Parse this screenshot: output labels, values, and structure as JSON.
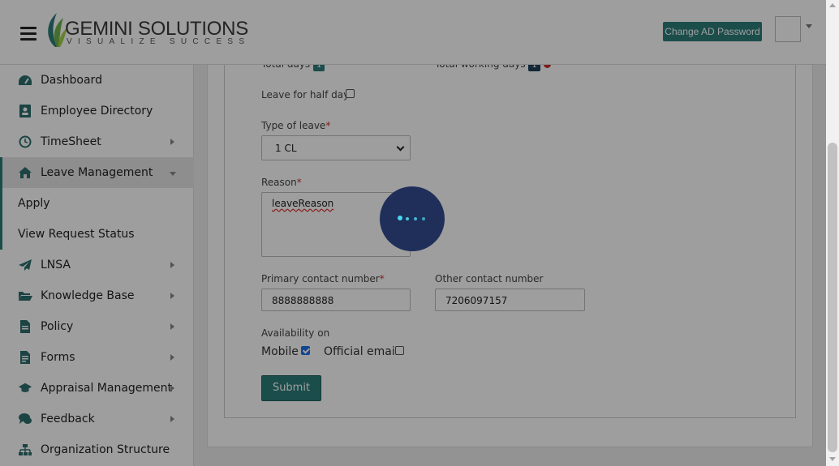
{
  "header": {
    "logo_title": "GEMINI SOLUTIONS",
    "logo_tagline": "VISUALIZE SUCCESS",
    "change_password_label": "Change AD Password"
  },
  "sidebar": {
    "items": [
      {
        "label": "Dashboard",
        "icon": "dashboard-icon"
      },
      {
        "label": "Employee Directory",
        "icon": "address-book-icon"
      },
      {
        "label": "TimeSheet",
        "icon": "clock-icon"
      },
      {
        "label": "Leave Management",
        "icon": "home-icon"
      },
      {
        "label": "Apply"
      },
      {
        "label": "View Request Status"
      },
      {
        "label": "LNSA",
        "icon": "paper-plane-icon"
      },
      {
        "label": "Knowledge Base",
        "icon": "folder-open-icon"
      },
      {
        "label": "Policy",
        "icon": "document-icon"
      },
      {
        "label": "Forms",
        "icon": "forms-icon"
      },
      {
        "label": "Appraisal Management",
        "icon": "graduation-cap-icon"
      },
      {
        "label": "Feedback",
        "icon": "comments-icon"
      },
      {
        "label": "Organization Structure",
        "icon": "sitemap-icon"
      }
    ]
  },
  "form": {
    "total_days_label": "Total days",
    "total_days_value": "1",
    "total_working_days_label": "Total working days",
    "total_working_days_value": "1",
    "half_day_label": "Leave for half day",
    "leave_type_label": "Type of leave",
    "leave_type_value": "1 CL",
    "reason_label": "Reason",
    "reason_value": "leaveReason",
    "primary_contact_label": "Primary contact number",
    "primary_contact_value": "8888888888",
    "other_contact_label": "Other contact number",
    "other_contact_value": "7206097157",
    "availability_label": "Availability on",
    "mobile_label": "Mobile",
    "mobile_checked": true,
    "email_label": "Official email",
    "email_checked": false,
    "required_mark": "*",
    "submit_label": "Submit"
  },
  "colors": {
    "accent": "#2d7d79",
    "required": "#c9302c",
    "spinner_bg": "#1f2f5a",
    "spinner_dots": "#4ad8f0"
  }
}
